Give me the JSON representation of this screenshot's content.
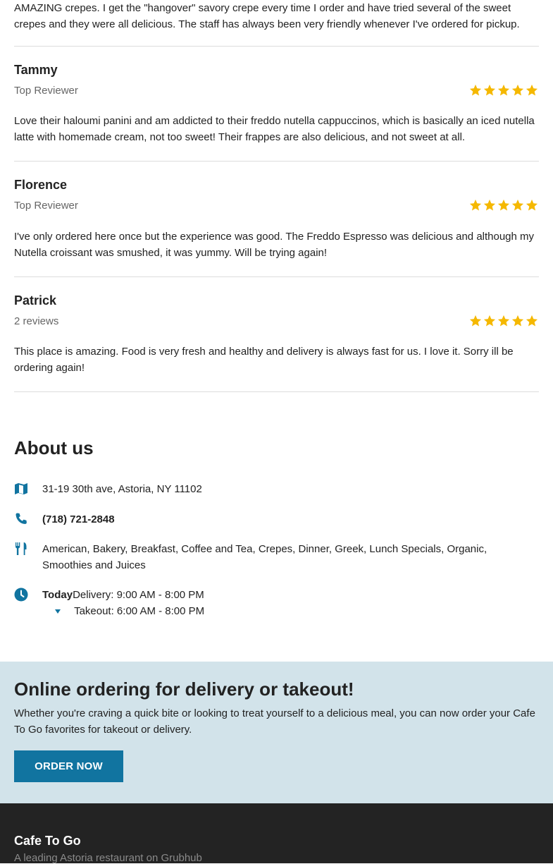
{
  "reviews": [
    {
      "text": "AMAZING crepes. I get the \"hangover\" savory crepe every time I order and have tried several of the sweet crepes and they were all delicious. The staff has always been very friendly whenever I've ordered for pickup."
    },
    {
      "name": "Tammy",
      "sub": "Top Reviewer",
      "rating": 5,
      "text": "Love their haloumi panini and am addicted to their freddo nutella cappuccinos, which is basically an iced nutella latte with homemade cream, not too sweet! Their frappes are also delicious, and not sweet at all."
    },
    {
      "name": "Florence",
      "sub": "Top Reviewer",
      "rating": 5,
      "text": "I've only ordered here once but the experience was good. The Freddo Espresso was delicious and although my Nutella croissant was smushed, it was yummy. Will be trying again!"
    },
    {
      "name": "Patrick",
      "sub": "2 reviews",
      "rating": 5,
      "text": "This place is amazing. Food is very fresh and healthy and delivery is always fast for us. I love it. Sorry ill be ordering again!"
    }
  ],
  "about": {
    "title": "About us",
    "address": "31-19 30th ave, Astoria, NY 11102",
    "phone": "(718) 721-2848",
    "cuisines": "American, Bakery, Breakfast, Coffee and Tea, Crepes, Dinner, Greek, Lunch Specials, Organic, Smoothies and Juices",
    "hours": {
      "today_label": "Today",
      "delivery": "Delivery: 9:00 AM - 8:00 PM",
      "takeout": "Takeout: 6:00 AM - 8:00 PM"
    }
  },
  "promo": {
    "title": "Online ordering for delivery or takeout!",
    "text": "Whether you're craving a quick bite or looking to treat yourself to a delicious meal, you can now order your Cafe To Go favorites for takeout or delivery.",
    "button": "ORDER NOW"
  },
  "footer": {
    "name": "Cafe To Go",
    "tagline": "A leading Astoria restaurant on Grubhub"
  },
  "colors": {
    "accent": "#1174a0",
    "star": "#f5b800",
    "promo_bg": "#d2e3ea",
    "footer_bg": "#232323"
  },
  "icons": {
    "address": "map-icon",
    "phone": "phone-icon",
    "cuisine": "fork-knife-icon",
    "hours": "clock-icon",
    "rating": "star-icon"
  }
}
